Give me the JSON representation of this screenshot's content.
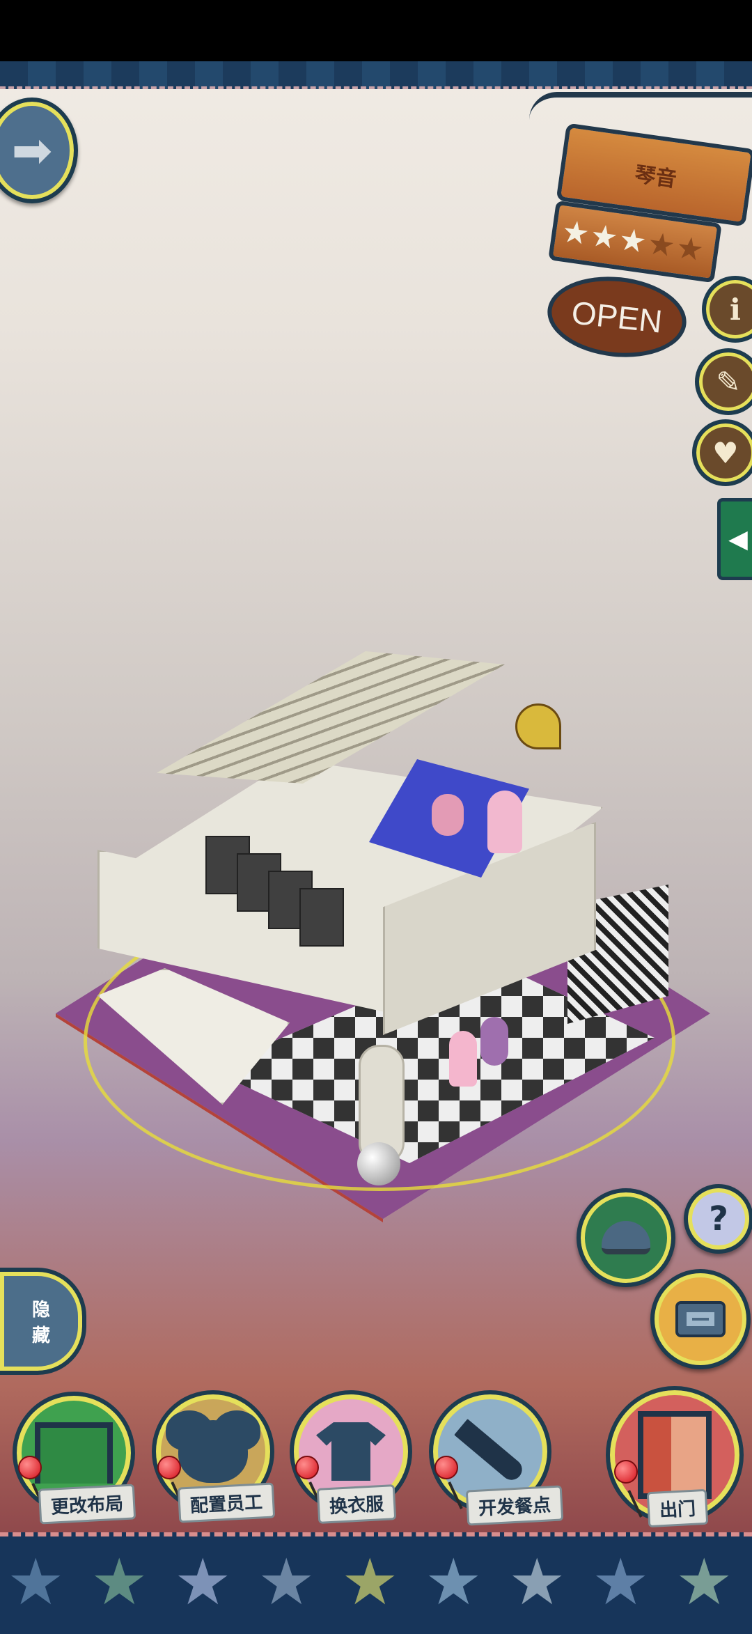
{
  "shop": {
    "name": "琴音",
    "rating_stars_filled": 3,
    "rating_stars_total": 5,
    "status": "OPEN"
  },
  "side_menu": {
    "info_icon": "info-icon",
    "book_icon": "book-icon",
    "heart_icon": "heart-chat-icon",
    "info_symbol": "i",
    "book_symbol": "✎",
    "heart_symbol": "♥",
    "tab_arrow": "◀"
  },
  "nav": {
    "back_arrow": "➡"
  },
  "hide_button": {
    "line1": "隐",
    "line2": "藏",
    "arrow": "⬇"
  },
  "tools": {
    "help_symbol": "?",
    "hat_icon": "bowler-hat-icon",
    "camera_icon": "camera-icon",
    "camera_symbol": "📷"
  },
  "bottom_menu": [
    {
      "label": "更改布局",
      "icon": "table-icon",
      "color": "#3fa14f",
      "symbol": "⬛"
    },
    {
      "label": "配置员工",
      "icon": "bear-icon",
      "color": "#c9a65a",
      "symbol": "🐻"
    },
    {
      "label": "换衣服",
      "icon": "shirt-icon",
      "color": "#e5a8c6",
      "symbol": "👕"
    },
    {
      "label": "开发餐点",
      "icon": "knife-icon",
      "color": "#8fb0c8",
      "symbol": "🔪"
    },
    {
      "label": "出门",
      "icon": "door-exit-icon",
      "color": "#d3605d",
      "symbol": "🚪"
    }
  ],
  "colors": {
    "frame": "#1d3c4f",
    "ring": "#e5e05b",
    "wood": "#c9763a"
  }
}
